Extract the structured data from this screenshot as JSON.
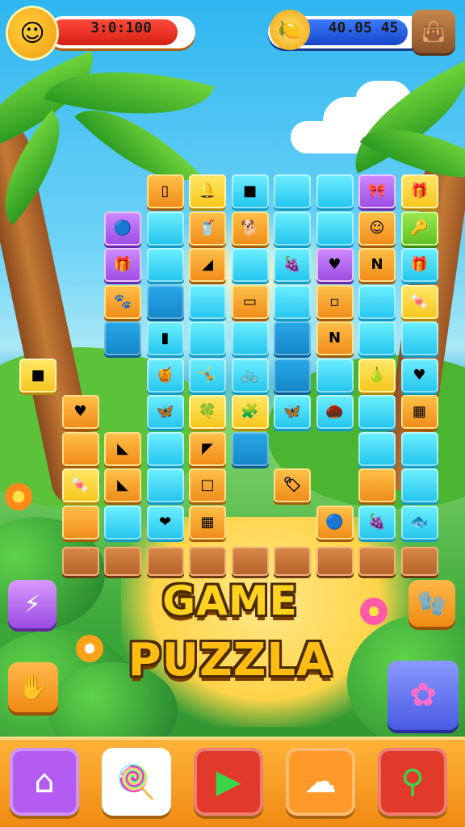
{
  "hud": {
    "left_value_text": "3:0:100",
    "left_bar_progress": 0.9,
    "right_value_text": "40.05 45",
    "right_bar_progress": 0.9,
    "avatar_icon": "sun-face-icon",
    "coin_icon": "fruit-icon",
    "menu_icon": "bag-icon"
  },
  "title": {
    "line1": "GAME",
    "line2": "PUZZLA"
  },
  "grid": {
    "tiles": [
      {
        "c": 3,
        "r": 0,
        "t": "o",
        "i": "▯"
      },
      {
        "c": 4,
        "r": 0,
        "t": "y",
        "i": "🔔"
      },
      {
        "c": 5,
        "r": 0,
        "t": "b",
        "i": "■"
      },
      {
        "c": 6,
        "r": 0,
        "t": "b",
        "i": ""
      },
      {
        "c": 7,
        "r": 0,
        "t": "b",
        "i": ""
      },
      {
        "c": 8,
        "r": 0,
        "t": "p",
        "i": "🎀"
      },
      {
        "c": 9,
        "r": 0,
        "t": "y",
        "i": "🎁"
      },
      {
        "c": 2,
        "r": 1,
        "t": "p",
        "i": "🔵"
      },
      {
        "c": 3,
        "r": 1,
        "t": "b",
        "i": ""
      },
      {
        "c": 4,
        "r": 1,
        "t": "o",
        "i": "🥤"
      },
      {
        "c": 5,
        "r": 1,
        "t": "o",
        "i": "🐕"
      },
      {
        "c": 6,
        "r": 1,
        "t": "b",
        "i": ""
      },
      {
        "c": 7,
        "r": 1,
        "t": "b",
        "i": ""
      },
      {
        "c": 8,
        "r": 1,
        "t": "o",
        "i": "☺"
      },
      {
        "c": 9,
        "r": 1,
        "t": "g",
        "i": "🔑"
      },
      {
        "c": 2,
        "r": 2,
        "t": "p",
        "i": "🎁"
      },
      {
        "c": 3,
        "r": 2,
        "t": "b",
        "i": ""
      },
      {
        "c": 4,
        "r": 2,
        "t": "o",
        "i": "◢"
      },
      {
        "c": 5,
        "r": 2,
        "t": "b",
        "i": ""
      },
      {
        "c": 6,
        "r": 2,
        "t": "b",
        "i": "🍇"
      },
      {
        "c": 7,
        "r": 2,
        "t": "p",
        "i": "♥"
      },
      {
        "c": 8,
        "r": 2,
        "t": "o",
        "i": "N"
      },
      {
        "c": 9,
        "r": 2,
        "t": "b",
        "i": "🎁"
      },
      {
        "c": 2,
        "r": 3,
        "t": "o",
        "i": "🐾"
      },
      {
        "c": 3,
        "r": 3,
        "t": "f",
        "i": ""
      },
      {
        "c": 4,
        "r": 3,
        "t": "b",
        "i": ""
      },
      {
        "c": 5,
        "r": 3,
        "t": "o",
        "i": "▭"
      },
      {
        "c": 6,
        "r": 3,
        "t": "b",
        "i": ""
      },
      {
        "c": 7,
        "r": 3,
        "t": "o",
        "i": "▫"
      },
      {
        "c": 8,
        "r": 3,
        "t": "b",
        "i": ""
      },
      {
        "c": 9,
        "r": 3,
        "t": "y",
        "i": "🍬"
      },
      {
        "c": 2,
        "r": 4,
        "t": "f",
        "i": ""
      },
      {
        "c": 3,
        "r": 4,
        "t": "b",
        "i": "▮"
      },
      {
        "c": 4,
        "r": 4,
        "t": "b",
        "i": ""
      },
      {
        "c": 5,
        "r": 4,
        "t": "b",
        "i": ""
      },
      {
        "c": 6,
        "r": 4,
        "t": "f",
        "i": ""
      },
      {
        "c": 7,
        "r": 4,
        "t": "o",
        "i": "N"
      },
      {
        "c": 8,
        "r": 4,
        "t": "b",
        "i": ""
      },
      {
        "c": 9,
        "r": 4,
        "t": "b",
        "i": ""
      },
      {
        "c": 0,
        "r": 5,
        "t": "y",
        "i": "■"
      },
      {
        "c": 3,
        "r": 5,
        "t": "b",
        "i": "🍯"
      },
      {
        "c": 4,
        "r": 5,
        "t": "b",
        "i": "🤸"
      },
      {
        "c": 5,
        "r": 5,
        "t": "b",
        "i": "🚲"
      },
      {
        "c": 6,
        "r": 5,
        "t": "f",
        "i": ""
      },
      {
        "c": 7,
        "r": 5,
        "t": "b",
        "i": ""
      },
      {
        "c": 8,
        "r": 5,
        "t": "y",
        "i": "🍐"
      },
      {
        "c": 9,
        "r": 5,
        "t": "b",
        "i": "♥"
      },
      {
        "c": 1,
        "r": 6,
        "t": "o",
        "i": "♥"
      },
      {
        "c": 3,
        "r": 6,
        "t": "b",
        "i": "🦋"
      },
      {
        "c": 4,
        "r": 6,
        "t": "y",
        "i": "🍀"
      },
      {
        "c": 5,
        "r": 6,
        "t": "y",
        "i": "🧩"
      },
      {
        "c": 6,
        "r": 6,
        "t": "b",
        "i": "🦋"
      },
      {
        "c": 7,
        "r": 6,
        "t": "b",
        "i": "🌰"
      },
      {
        "c": 8,
        "r": 6,
        "t": "b",
        "i": ""
      },
      {
        "c": 9,
        "r": 6,
        "t": "o",
        "i": "▦"
      },
      {
        "c": 1,
        "r": 7,
        "t": "o",
        "i": ""
      },
      {
        "c": 2,
        "r": 7,
        "t": "o",
        "i": "◣"
      },
      {
        "c": 3,
        "r": 7,
        "t": "b",
        "i": ""
      },
      {
        "c": 4,
        "r": 7,
        "t": "o",
        "i": "◤"
      },
      {
        "c": 5,
        "r": 7,
        "t": "f",
        "i": ""
      },
      {
        "c": 8,
        "r": 7,
        "t": "b",
        "i": ""
      },
      {
        "c": 9,
        "r": 7,
        "t": "b",
        "i": ""
      },
      {
        "c": 1,
        "r": 8,
        "t": "y",
        "i": "🍬"
      },
      {
        "c": 2,
        "r": 8,
        "t": "o",
        "i": "◣"
      },
      {
        "c": 3,
        "r": 8,
        "t": "b",
        "i": ""
      },
      {
        "c": 4,
        "r": 8,
        "t": "o",
        "i": "□"
      },
      {
        "c": 6,
        "r": 8,
        "t": "o",
        "i": "🏷"
      },
      {
        "c": 8,
        "r": 8,
        "t": "o",
        "i": ""
      },
      {
        "c": 9,
        "r": 8,
        "t": "b",
        "i": ""
      },
      {
        "c": 1,
        "r": 9,
        "t": "o",
        "i": ""
      },
      {
        "c": 2,
        "r": 9,
        "t": "b",
        "i": ""
      },
      {
        "c": 3,
        "r": 9,
        "t": "b",
        "i": "❤"
      },
      {
        "c": 4,
        "r": 9,
        "t": "o",
        "i": "▦"
      },
      {
        "c": 7,
        "r": 9,
        "t": "o",
        "i": "🔵"
      },
      {
        "c": 8,
        "r": 9,
        "t": "b",
        "i": "🍇"
      },
      {
        "c": 9,
        "r": 9,
        "t": "b",
        "i": "🐟"
      },
      {
        "c": 1,
        "r": 10,
        "t": "d",
        "i": ""
      },
      {
        "c": 2,
        "r": 10,
        "t": "d",
        "i": ""
      },
      {
        "c": 3,
        "r": 10,
        "t": "d",
        "i": ""
      },
      {
        "c": 4,
        "r": 10,
        "t": "d",
        "i": ""
      },
      {
        "c": 5,
        "r": 10,
        "t": "d",
        "i": ""
      },
      {
        "c": 6,
        "r": 10,
        "t": "d",
        "i": ""
      },
      {
        "c": 7,
        "r": 10,
        "t": "d",
        "i": ""
      },
      {
        "c": 8,
        "r": 10,
        "t": "d",
        "i": ""
      },
      {
        "c": 9,
        "r": 10,
        "t": "d",
        "i": ""
      }
    ]
  },
  "side_buttons": {
    "left_top_icon": "lightning-icon",
    "left_bottom_icon": "hand-icon",
    "right_top_icon": "glove-icon",
    "right_bottom_icon": "flower-icon"
  },
  "bottom_bar": {
    "buttons": [
      {
        "name": "home-button",
        "icon": "⌂",
        "icon_name": "home-icon",
        "color": "#b45cf2"
      },
      {
        "name": "candy-button",
        "icon": "🍭",
        "icon_name": "candy-icon",
        "color": "#ffffff"
      },
      {
        "name": "play-button",
        "icon": "▶",
        "icon_name": "play-icon",
        "color": "#e23a2a"
      },
      {
        "name": "cloud-button",
        "icon": "☁",
        "icon_name": "cloud-icon",
        "color": "#ff9a2a"
      },
      {
        "name": "search-button",
        "icon": "⚲",
        "icon_name": "search-icon",
        "color": "#e23a2a"
      }
    ]
  }
}
